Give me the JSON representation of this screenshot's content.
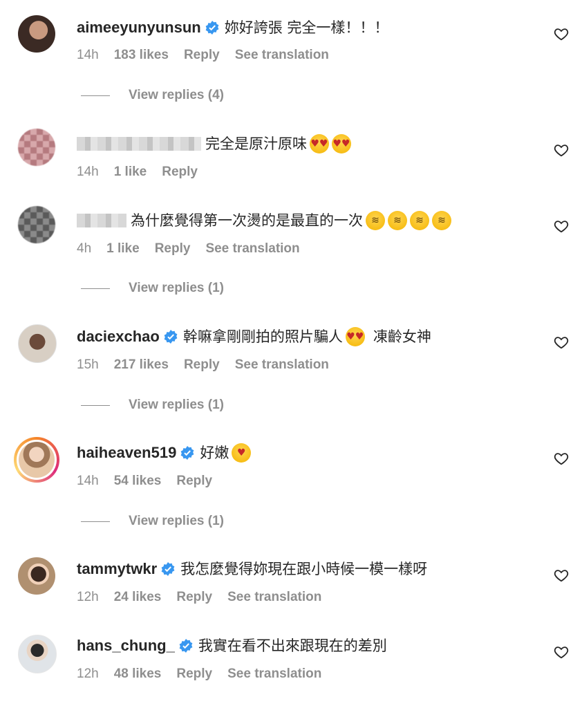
{
  "comments": [
    {
      "username": "aimeeyunyunsun",
      "verified": true,
      "text": "妳好誇張 完全一樣！！！",
      "time": "14h",
      "likes": "183 likes",
      "reply": "Reply",
      "translate": "See translation",
      "view_replies": "View replies (4)",
      "avatar_color": "#3b2a24"
    },
    {
      "username": "",
      "verified": false,
      "text": "完全是原汁原味",
      "emojis": [
        "heart-eyes-emoji",
        "heart-eyes-emoji"
      ],
      "time": "14h",
      "likes": "1 like",
      "reply": "Reply",
      "avatar_color": "#b57a7f"
    },
    {
      "username": "",
      "verified": false,
      "text": "為什麼覺得第一次燙的是最直的一次",
      "emojis": [
        "rofl-emoji",
        "rofl-emoji",
        "rofl-emoji",
        "rofl-emoji"
      ],
      "time": "4h",
      "likes": "1 like",
      "reply": "Reply",
      "translate": "See translation",
      "view_replies": "View replies (1)",
      "avatar_color": "#5a5a5a"
    },
    {
      "username": "daciexchao",
      "verified": true,
      "text": "幹嘛拿剛剛拍的照片騙人",
      "emojis": [
        "heart-eyes-emoji"
      ],
      "text2": "凍齡女神",
      "time": "15h",
      "likes": "217 likes",
      "reply": "Reply",
      "translate": "See translation",
      "view_replies": "View replies (1)",
      "avatar_color": "#d8cfc4"
    },
    {
      "username": "haiheaven519",
      "verified": true,
      "text": "好嫩",
      "emojis": [
        "kiss-emoji"
      ],
      "time": "14h",
      "likes": "54 likes",
      "reply": "Reply",
      "view_replies": "View replies (1)",
      "avatar_color": "#e8c8a8"
    },
    {
      "username": "tammytwkr",
      "verified": true,
      "text": "我怎麼覺得妳現在跟小時候一模一樣呀",
      "time": "12h",
      "likes": "24 likes",
      "reply": "Reply",
      "translate": "See translation",
      "avatar_color": "#b09070"
    },
    {
      "username": "hans_chung_",
      "verified": true,
      "text": "我實在看不出來跟現在的差別",
      "time": "12h",
      "likes": "48 likes",
      "reply": "Reply",
      "translate": "See translation",
      "avatar_color": "#e0e4e8"
    }
  ],
  "colors": {
    "verified_blue": "#3897f0",
    "secondary_text": "#8e8e8e",
    "primary_text": "#262626"
  },
  "icons": {
    "heart": "heart-outline-icon",
    "verified": "verified-badge-icon"
  }
}
